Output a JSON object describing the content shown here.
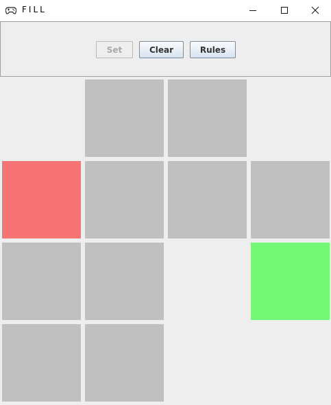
{
  "window": {
    "title": "FILL",
    "app_icon": "gamepad-icon",
    "controls": [
      "minimize-icon",
      "maximize-icon",
      "close-icon"
    ]
  },
  "toolbar": {
    "set_label": "Set",
    "clear_label": "Clear",
    "rules_label": "Rules",
    "set_enabled": false
  },
  "colors": {
    "window_bg": "#eeeeee",
    "empty_cell": "#eeeeee",
    "filled_cell": "#c0c0c0",
    "start_cell": "#f77474",
    "end_cell": "#74f774"
  },
  "board": {
    "rows": 4,
    "cols": 4,
    "cells": [
      [
        "empty",
        "filled",
        "filled",
        "empty"
      ],
      [
        "start",
        "filled",
        "filled",
        "filled"
      ],
      [
        "filled",
        "filled",
        "empty",
        "end"
      ],
      [
        "filled",
        "filled",
        "empty",
        "empty"
      ]
    ]
  }
}
